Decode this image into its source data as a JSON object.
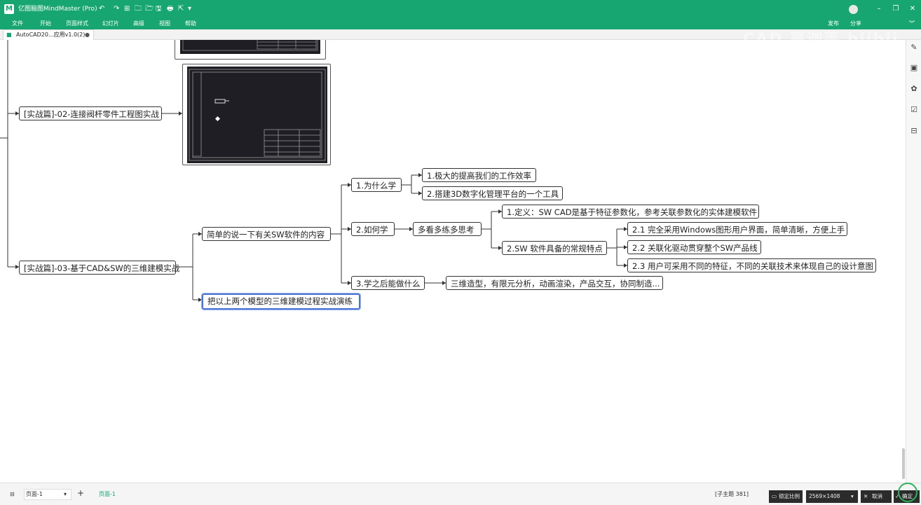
{
  "app": {
    "title": "亿图脑图MindMaster (Pro)",
    "accent_color": "#17a672"
  },
  "quick_access": [
    "↶",
    "↷",
    "⊞",
    "🗀",
    "🗁",
    "🖫",
    "🖶",
    "⇱",
    "▾"
  ],
  "window_controls": {
    "minimize": "–",
    "restore": "❐",
    "close": "✕"
  },
  "menu": [
    "文件",
    "开始",
    "页面样式",
    "幻灯片",
    "高级",
    "视图",
    "帮助"
  ],
  "ribbon_right": {
    "publish": "发布",
    "share": "分享"
  },
  "doc_tab": {
    "label": "AutoCAD20...应用v1.0(2)",
    "close": "●"
  },
  "watermark": "CAD 高迦芙 blibli",
  "mindmap": {
    "branch_02": "[实战篇]-02-连接阀杆零件工程图实战",
    "branch_03": "[实战篇]-03-基于CAD&SW的三维建模实战",
    "sub_intro": "简单的说一下有关SW软件的内容",
    "sub_practice": "把以上两个模型的三维建模过程实战演练",
    "why": "1.为什么学",
    "why_1": "1.极大的提高我们的工作效率",
    "why_2": "2.搭建3D数字化管理平台的一个工具",
    "how": "2.如何学",
    "how_method": "多看多练多思考",
    "def": "1.定义：SW CAD是基于特征参数化，参考关联参数化的实体建模软件",
    "features": "2.SW 软件具备的常规特点",
    "feat_1": "2.1 完全采用Windows图形用户界面，简单清晰，方便上手",
    "feat_2": "2.2 关联化驱动贯穿整个SW产品线",
    "feat_3": "2.3 用户可采用不同的特征，不同的关联技术来体现自己的设计意图",
    "after": "3.学之后能做什么",
    "after_1": "三维造型，有限元分析，动画渲染，产品交互，协同制造..."
  },
  "sidebar_icons": [
    "style-icon",
    "image-icon",
    "clipart-icon",
    "task-icon",
    "outline-icon"
  ],
  "status": {
    "page_select": "页面-1",
    "add_page": "+",
    "page_tab": "页面-1",
    "topic_count": "[子主题 381]",
    "lock_ratio": "锁定比例",
    "resolution": "2569×1408",
    "cancel": "取消",
    "confirm": "确定"
  }
}
